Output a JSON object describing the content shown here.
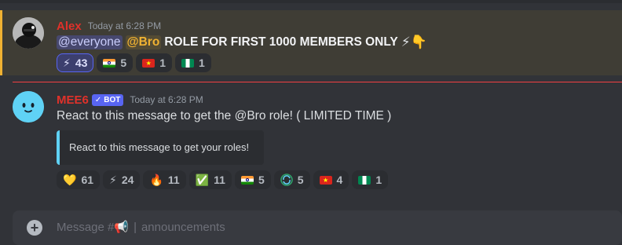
{
  "colors": {
    "background": "#313338",
    "highlight_background": "#3f3d35",
    "highlight_bar": "#f0b232",
    "author_name": "#e0312a",
    "new_message_divider": "#f23f43",
    "bot_tag": "#5865f2",
    "embed_accent": "#5fd2f5",
    "composer": "#383a40"
  },
  "messages": [
    {
      "author": "Alex",
      "timestamp": "Today at 6:28 PM",
      "avatar_icon": "dark-hooded-figure-avatar",
      "mention_everyone": "@everyone",
      "mention_role": "@Bro",
      "text": "ROLE FOR FIRST 1000 MEMBERS ONLY",
      "trailing_emoji": "⚡👇",
      "reactions": [
        {
          "icon": "lightning-emoji",
          "glyph": "⚡",
          "count": "43",
          "me": true
        },
        {
          "icon": "india-flag",
          "glyph": "",
          "count": "5",
          "me": false
        },
        {
          "icon": "vietnam-flag",
          "glyph": "★",
          "count": "1",
          "me": false
        },
        {
          "icon": "nigeria-flag",
          "glyph": "",
          "count": "1",
          "me": false
        }
      ]
    },
    {
      "author": "MEE6",
      "bot_label": "BOT",
      "timestamp": "Today at 6:28 PM",
      "avatar_icon": "mee6-face-avatar",
      "text": "React to this message to get the @Bro role! ( LIMITED TIME )",
      "embed_text": "React to this message to get your roles!",
      "reactions": [
        {
          "icon": "yellow-heart-emoji",
          "glyph": "💛",
          "count": "61"
        },
        {
          "icon": "lightning-emoji",
          "glyph": "⚡",
          "count": "24"
        },
        {
          "icon": "fire-emoji",
          "glyph": "🔥",
          "count": "11"
        },
        {
          "icon": "check-mark-emoji",
          "glyph": "✅",
          "count": "11"
        },
        {
          "icon": "india-flag",
          "glyph": "",
          "count": "5"
        },
        {
          "icon": "recycle-globe-emoji",
          "glyph": "",
          "count": "5"
        },
        {
          "icon": "vietnam-flag",
          "glyph": "★",
          "count": "4"
        },
        {
          "icon": "nigeria-flag",
          "glyph": "",
          "count": "1"
        }
      ]
    }
  ],
  "composer": {
    "placeholder_prefix": "Message #",
    "channel_emoji": "📢",
    "separator": "|",
    "channel_name": "announcements"
  }
}
